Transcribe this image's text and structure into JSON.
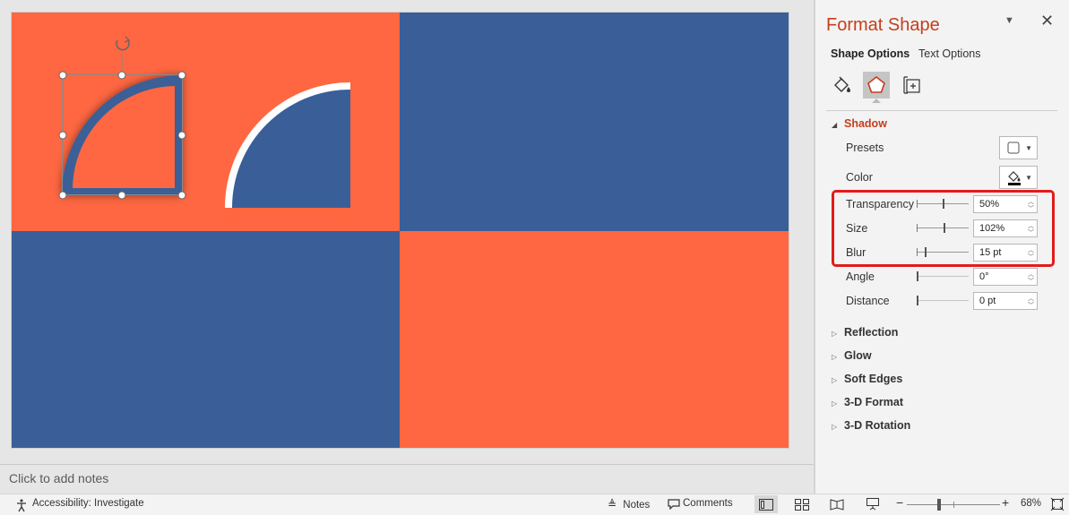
{
  "colors": {
    "orange": "#fe6741",
    "blue": "#3a5e97",
    "accent": "#c43e1c",
    "highlight": "#e31b1b"
  },
  "notes": {
    "placeholder": "Click to add notes"
  },
  "format_pane": {
    "title": "Format Shape",
    "tabs": {
      "shape_options": "Shape Options",
      "text_options": "Text Options"
    },
    "category_icons": [
      "fill-line-icon",
      "effects-pentagon-icon",
      "size-properties-icon"
    ],
    "shadow": {
      "header": "Shadow",
      "presets_label": "Presets",
      "color_label": "Color",
      "transparency": {
        "label": "Transparency",
        "value": "50%",
        "level": 0.5
      },
      "size": {
        "label": "Size",
        "value": "102%",
        "level": 0.51
      },
      "blur": {
        "label": "Blur",
        "value": "15 pt",
        "level": 0.15
      },
      "angle": {
        "label": "Angle",
        "value": "0°",
        "level": 0
      },
      "distance": {
        "label": "Distance",
        "value": "0 pt",
        "level": 0
      }
    },
    "sections": [
      "Reflection",
      "Glow",
      "Soft Edges",
      "3-D Format",
      "3-D Rotation"
    ]
  },
  "status_bar": {
    "accessibility": "Accessibility: Investigate",
    "notes": "Notes",
    "comments": "Comments",
    "zoom": "68%",
    "zoom_level": 0.68
  }
}
